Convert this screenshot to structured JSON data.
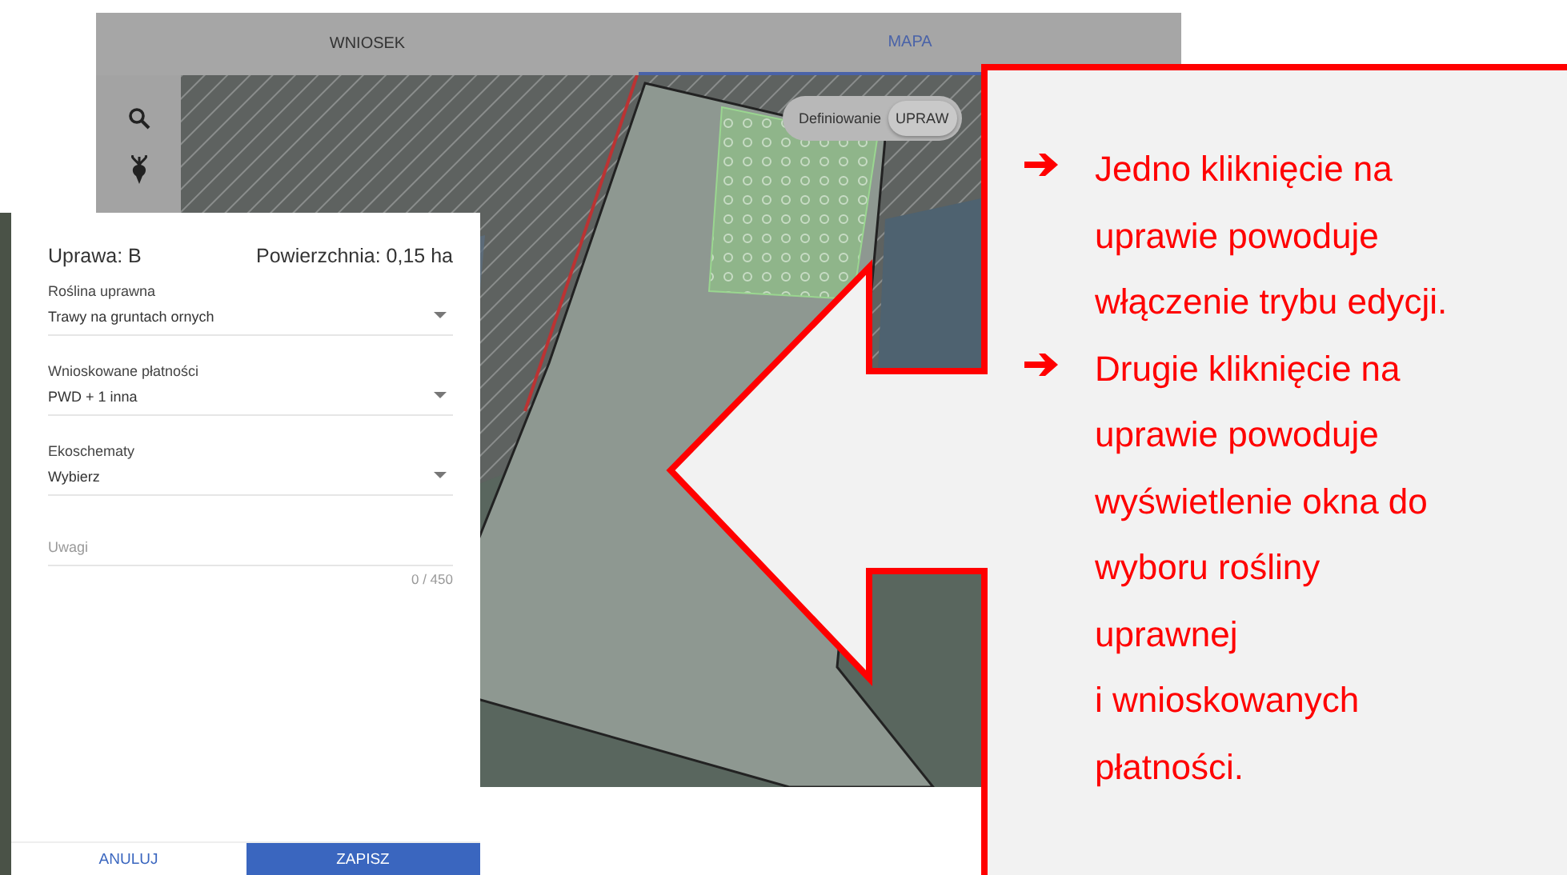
{
  "app": {
    "tabs": [
      {
        "label": "WNIOSEK",
        "selected": false
      },
      {
        "label": "MAPA",
        "selected": true
      }
    ],
    "mode_toggle": {
      "label": "Definiowanie",
      "option": "UPRAW",
      "on": true
    }
  },
  "dialog": {
    "title": "Uprawa: B",
    "area": "Powierzchnia: 0,15 ha",
    "fields": [
      {
        "kind": "select",
        "label": "Roślina uprawna",
        "value": "Trawy na gruntach ornych"
      },
      {
        "kind": "select",
        "label": "Wnioskowane płatności",
        "value": "PWD + 1 inna"
      },
      {
        "kind": "select",
        "label": "Ekoschematy",
        "value": "Wybierz"
      },
      {
        "kind": "textarea",
        "placeholder": "Uwagi",
        "counter": "0 / 450"
      }
    ],
    "buttons": [
      {
        "label": "ANULUJ",
        "kind": "secondary"
      },
      {
        "label": "ZAPISZ",
        "kind": "primary"
      }
    ]
  },
  "callout": {
    "items": [
      "Jedno kliknięcie na\nuprawie powoduje\nwłączenie trybu edycji.",
      "Drugie kliknięcie na\nuprawie powoduje\nwyświetlenie okna do\nwyboru rośliny\nuprawnej\ni wnioskowanych\npłatności."
    ]
  }
}
